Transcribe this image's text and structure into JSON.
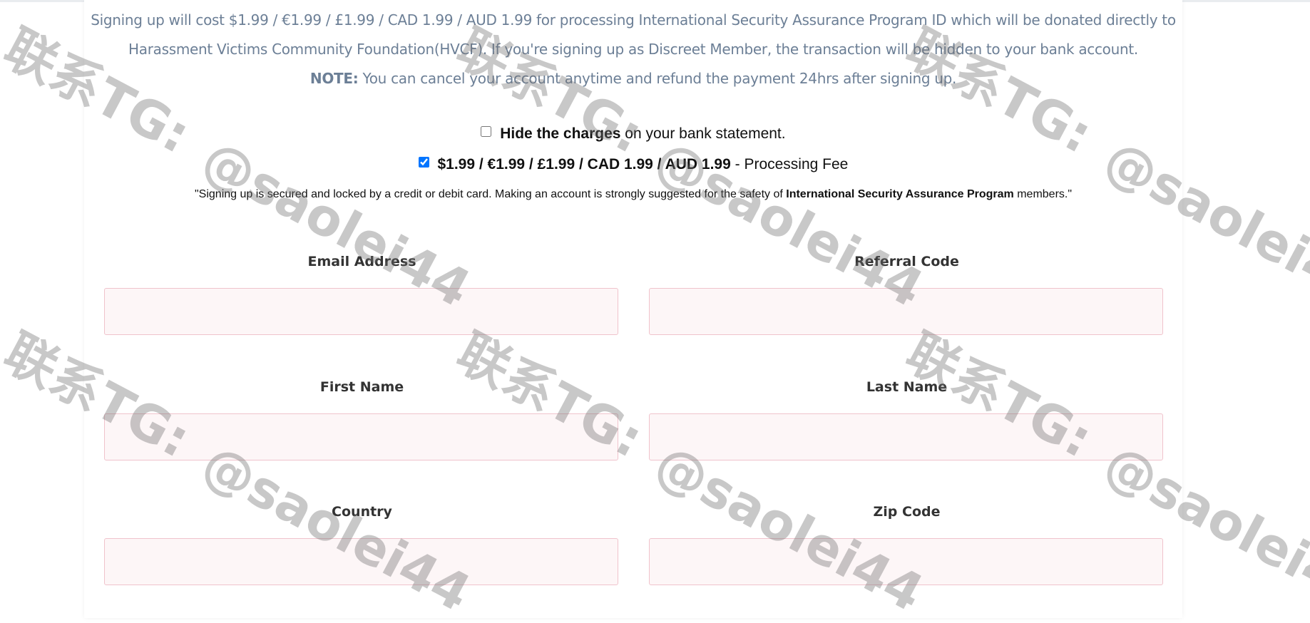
{
  "info": {
    "line1": "Signing up will cost $1.99 / €1.99 / £1.99 / CAD 1.99 / AUD 1.99 for processing International Security Assurance Program ID which will be donated directly to",
    "line2": "Harassment Victims Community Foundation(HVCF). If you're signing up as Discreet Member, the transaction will be hidden to your bank account.",
    "note_label": "NOTE:",
    "note_text": " You can cancel your account anytime and refund the payment 24hrs after signing up."
  },
  "hide_charges": {
    "checked": false,
    "bold": "Hide the charges",
    "text": " on your bank statement."
  },
  "processing_fee": {
    "checked": true,
    "bold": "$1.99 / €1.99 / £1.99 / CAD 1.99 / AUD 1.99",
    "text": " - Processing Fee"
  },
  "quote": {
    "before": "\"Signing up is secured and locked by a credit or debit card. Making an account is strongly suggested for the safety of ",
    "bold": "International Security Assurance Program",
    "after": " members.\""
  },
  "form": {
    "email_label": "Email Address",
    "email_value": "",
    "referral_label": "Referral Code",
    "referral_value": "",
    "first_name_label": "First Name",
    "first_name_value": "",
    "last_name_label": "Last Name",
    "last_name_value": "",
    "country_label": "Country",
    "country_value": "",
    "zip_label": "Zip Code",
    "zip_value": ""
  },
  "watermark": {
    "line1": "联系TG:",
    "line2": "@saolei44"
  },
  "colors": {
    "info_text": "#6c7f96",
    "input_border": "#f0c3cc",
    "input_bg": "#fdf6f7"
  }
}
